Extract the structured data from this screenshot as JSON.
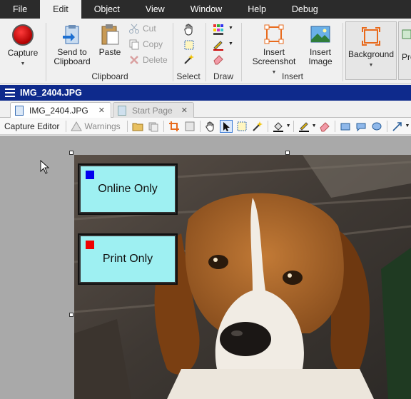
{
  "menu": {
    "items": [
      "File",
      "Edit",
      "Object",
      "View",
      "Window",
      "Help",
      "Debug"
    ],
    "active": "Edit"
  },
  "ribbon": {
    "capture": {
      "label": "Capture"
    },
    "send_to_clipboard": {
      "line1": "Send to",
      "line2": "Clipboard"
    },
    "paste": {
      "label": "Paste"
    },
    "cut": {
      "label": "Cut"
    },
    "copy": {
      "label": "Copy"
    },
    "delete": {
      "label": "Delete"
    },
    "insert_screenshot": {
      "line1": "Insert",
      "line2": "Screenshot"
    },
    "insert_image": {
      "line1": "Insert",
      "line2": "Image"
    },
    "background": {
      "label": "Background"
    },
    "partial_label": "Pro",
    "groups": {
      "clipboard": "Clipboard",
      "select": "Select",
      "draw": "Draw",
      "insert": "Insert"
    }
  },
  "document": {
    "title": "IMG_2404.JPG"
  },
  "tabs": [
    {
      "label": "IMG_2404.JPG",
      "active": true
    },
    {
      "label": "Start Page",
      "active": false
    }
  ],
  "toolbar": {
    "capture_editor": "Capture Editor",
    "warnings": "Warnings"
  },
  "callouts": [
    {
      "text": "Online Only",
      "marker_color": "#0000ee"
    },
    {
      "text": "Print Only",
      "marker_color": "#ee0000"
    }
  ],
  "colors": {
    "menubar_bg": "#2b2b2b",
    "doc_title_bg": "#0e2a8c",
    "callout_fill": "#9ef0f2",
    "canvas_bg": "#a9a9a9"
  }
}
